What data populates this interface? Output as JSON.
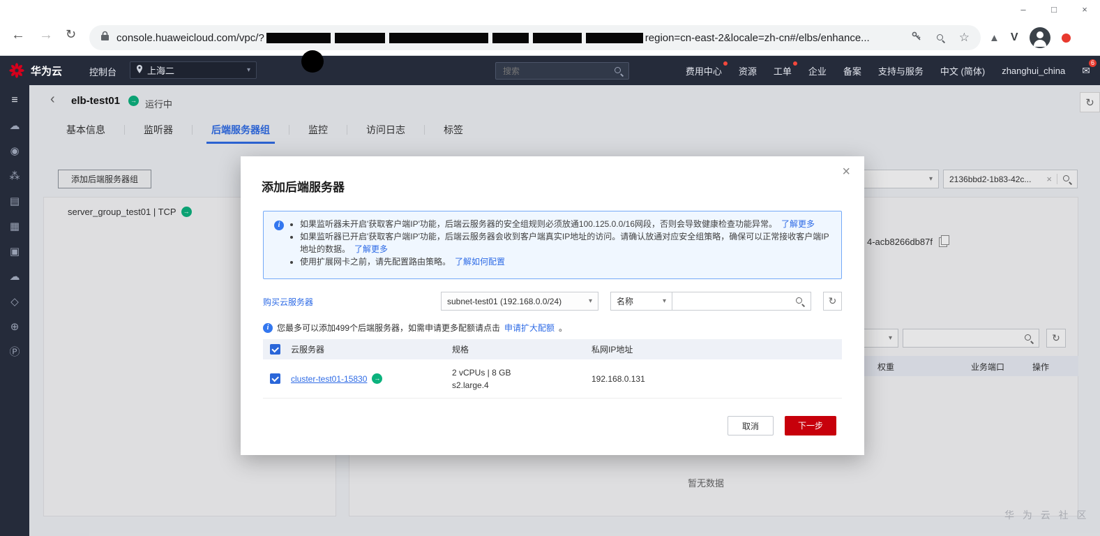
{
  "glyphs": {
    "back_nav": "←",
    "forward_nav": "→",
    "reload": "↻",
    "star": "☆",
    "minimize": "–",
    "maximize": "□",
    "close": "×",
    "caret": "▾",
    "breadcrumb_back": "‹",
    "arrow": "→",
    "refresh": "↻",
    "clear": "×",
    "info": "i",
    "mail": "✉",
    "triangle": "▲",
    "v_letter": "V"
  },
  "browser": {
    "url_prefix": "console.huaweicloud.com/vpc/?",
    "url_suffix": "region=cn-east-2&locale=zh-cn#/elbs/enhance..."
  },
  "topnav": {
    "brand": "华为云",
    "console": "控制台",
    "region": "上海二",
    "search_placeholder": "搜索",
    "menu": [
      {
        "label": "费用中心"
      },
      {
        "label": "资源"
      },
      {
        "label": "工单"
      },
      {
        "label": "企业"
      },
      {
        "label": "备案"
      },
      {
        "label": "支持与服务"
      },
      {
        "label": "中文 (简体)"
      },
      {
        "label": "zhanghui_china"
      }
    ],
    "mail_badge": "6"
  },
  "sidebar": {
    "icons": [
      {
        "name": "menu",
        "glyph": "≡"
      },
      {
        "name": "elastic-cloud-server",
        "glyph": "☁"
      },
      {
        "name": "users",
        "glyph": "◉"
      },
      {
        "name": "cloud-cluster",
        "glyph": "⁂"
      },
      {
        "name": "storage",
        "glyph": "▤"
      },
      {
        "name": "document",
        "glyph": "▦"
      },
      {
        "name": "server",
        "glyph": "▣"
      },
      {
        "name": "cloud-service",
        "glyph": "☁"
      },
      {
        "name": "experiment",
        "glyph": "◇"
      },
      {
        "name": "network-globe",
        "glyph": "⊕"
      },
      {
        "name": "parking",
        "glyph": "Ⓟ"
      }
    ]
  },
  "page": {
    "title": "elb-test01",
    "status": "运行中",
    "tabs": [
      {
        "label": "基本信息"
      },
      {
        "label": "监听器"
      },
      {
        "label": "后端服务器组"
      },
      {
        "label": "监控"
      },
      {
        "label": "访问日志"
      },
      {
        "label": "标签"
      }
    ],
    "add_group_button": "添加后端服务器组",
    "server_group": "server_group_test01 | TCP",
    "search_value": "2136bbd2-1b83-42c...",
    "id_fragment": "4-acb8266db87f",
    "filter_headers": [
      "权重",
      "业务端口",
      "操作"
    ],
    "empty_text": "暂无数据",
    "watermark": "华 为 云 社 区"
  },
  "modal": {
    "title": "添加后端服务器",
    "notices": [
      {
        "text": "如果监听器未开启'获取客户端IP'功能，后端云服务器的安全组规则必须放通100.125.0.0/16网段，否则会导致健康检查功能异常。",
        "link": "了解更多"
      },
      {
        "text": "如果监听器已开启'获取客户端IP'功能，后端云服务器会收到客户端真实IP地址的访问。请确认放通对应安全组策略，确保可以正常接收客户端IP地址的数据。",
        "link": "了解更多"
      },
      {
        "text": "使用扩展网卡之前，请先配置路由策略。",
        "link": "了解如何配置"
      }
    ],
    "buy_link": "购买云服务器",
    "subnet_value": "subnet-test01 (192.168.0.0/24)",
    "filter_label": "名称",
    "quota_prefix": "您最多可以添加499个后端服务器，如需申请更多配额请点击",
    "quota_link": "申请扩大配额",
    "quota_suffix": "。",
    "table_headers": [
      "云服务器",
      "规格",
      "私网IP地址"
    ],
    "row": {
      "name": "cluster-test01-15830",
      "spec1": "2 vCPUs | 8 GB",
      "spec2": "s2.large.4",
      "ip": "192.168.0.131"
    },
    "cancel": "取消",
    "next": "下一步"
  },
  "colors": {
    "brand_red": "#c7000b",
    "link_blue": "#2e6be6",
    "nav_dark": "#252b3a",
    "alert_bg": "#f0f7ff",
    "alert_border": "#74a9f7",
    "status_green": "#0bb27d"
  }
}
